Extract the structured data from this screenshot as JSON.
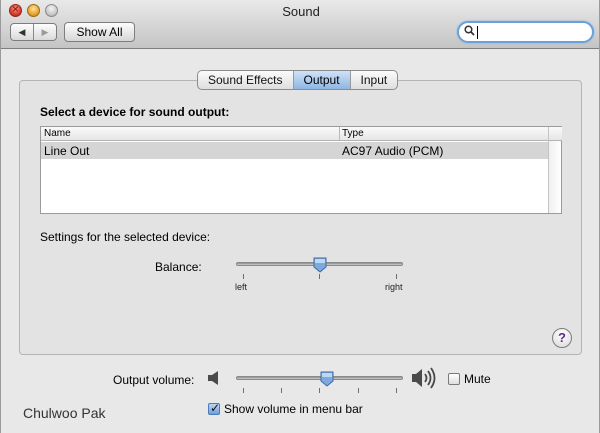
{
  "window": {
    "title": "Sound"
  },
  "toolbar": {
    "back_icon": "triangle-left-icon",
    "forward_icon": "triangle-right-icon",
    "show_all_label": "Show All"
  },
  "search": {
    "icon": "magnifier-icon",
    "value": "",
    "placeholder": ""
  },
  "tabs": [
    {
      "label": "Sound Effects",
      "selected": false
    },
    {
      "label": "Output",
      "selected": true
    },
    {
      "label": "Input",
      "selected": false
    }
  ],
  "output": {
    "heading": "Select a device for sound output:",
    "table": {
      "headers": [
        "Name",
        "Type"
      ],
      "rows": [
        {
          "name": "Line Out",
          "type": "AC97 Audio (PCM)",
          "selected": true
        }
      ]
    },
    "settings_heading": "Settings for the selected device:",
    "balance": {
      "label": "Balance:",
      "left_label": "left",
      "right_label": "right",
      "value": 0.5
    }
  },
  "footer": {
    "volume_label": "Output volume:",
    "volume_value": 0.55,
    "mute_label": "Mute",
    "mute_checked": false,
    "show_volume_label": "Show volume in menu bar",
    "show_volume_checked": true
  },
  "author": "Chulwoo Pak",
  "colors": {
    "selection_blue": "#8fb6e3",
    "row_selected": "#d5d5d5",
    "help_purple": "#5b2f86"
  }
}
